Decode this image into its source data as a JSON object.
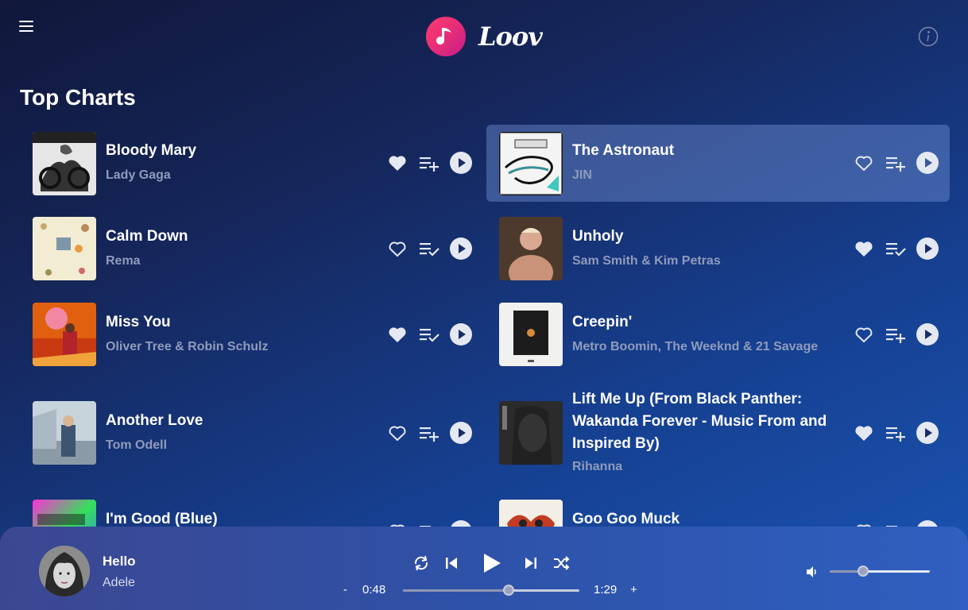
{
  "app": {
    "name": "Loov"
  },
  "section_title": "Top Charts",
  "tracks": [
    {
      "title": "Bloody Mary",
      "artist": "Lady Gaga",
      "liked": true,
      "queued": false,
      "selected": false
    },
    {
      "title": "The Astronaut",
      "artist": "JIN",
      "liked": false,
      "queued": false,
      "selected": true
    },
    {
      "title": "Calm Down",
      "artist": "Rema",
      "liked": false,
      "queued": true,
      "selected": false
    },
    {
      "title": "Unholy",
      "artist": "Sam Smith & Kim Petras",
      "liked": true,
      "queued": true,
      "selected": false
    },
    {
      "title": "Miss You",
      "artist": "Oliver Tree & Robin Schulz",
      "liked": true,
      "queued": true,
      "selected": false
    },
    {
      "title": "Creepin'",
      "artist": "Metro Boomin, The Weeknd & 21 Savage",
      "liked": false,
      "queued": false,
      "selected": false
    },
    {
      "title": "Another Love",
      "artist": "Tom Odell",
      "liked": false,
      "queued": false,
      "selected": false
    },
    {
      "title": "Lift Me Up (From Black Panther: Wakanda Forever - Music From and Inspired By)",
      "artist": "Rihanna",
      "liked": true,
      "queued": false,
      "selected": false
    },
    {
      "title": "I'm Good (Blue)",
      "artist": "",
      "liked": false,
      "queued": false,
      "selected": false
    },
    {
      "title": "Goo Goo Muck",
      "artist": "",
      "liked": false,
      "queued": false,
      "selected": false
    }
  ],
  "player": {
    "title": "Hello",
    "artist": "Adele",
    "elapsed": "0:48",
    "duration": "1:29",
    "progress": 0.6,
    "volume": 0.33,
    "minus_label": "-",
    "plus_label": "+"
  },
  "colors": {
    "accent": "#ff3c6e",
    "selected_row": "#5b74b8",
    "artist_text": "#8f9bbd",
    "player_bg": "#2e52a8"
  }
}
